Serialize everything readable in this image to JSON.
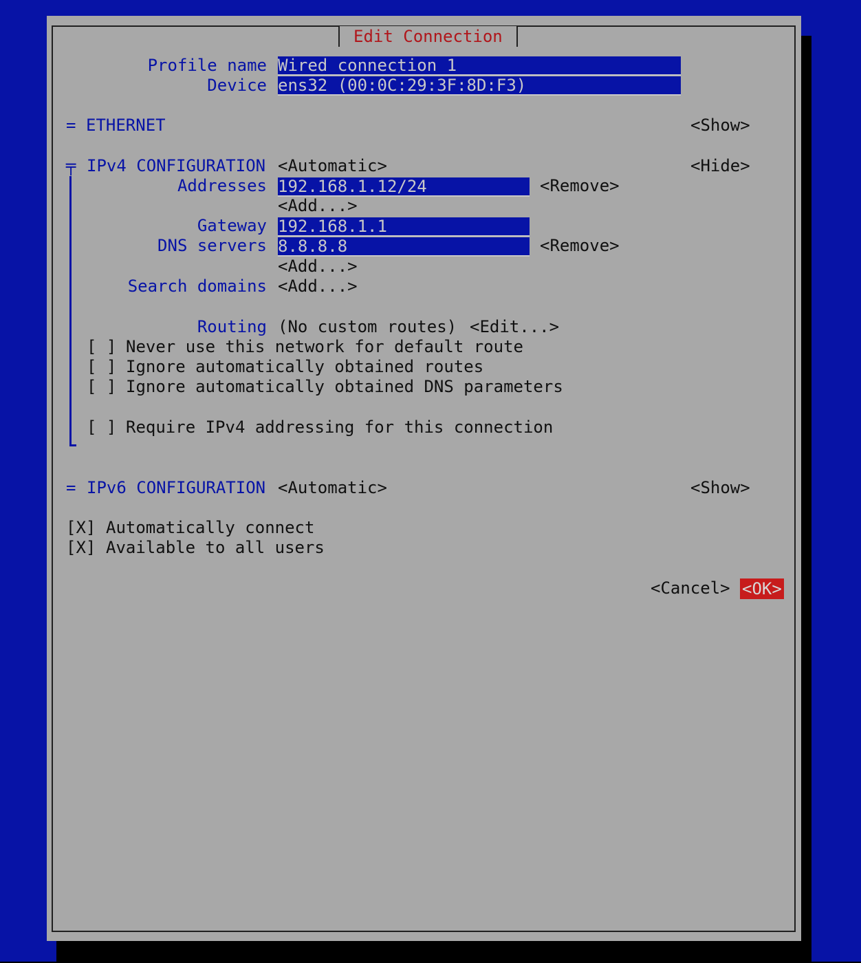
{
  "dialog": {
    "title": "Edit Connection"
  },
  "profile": {
    "name_label": "Profile name",
    "name_value": "Wired connection 1",
    "device_label": "Device",
    "device_value": "ens32 (00:0C:29:3F:8D:F3)"
  },
  "ethernet": {
    "marker": "=",
    "heading": "ETHERNET",
    "toggle": "<Show>"
  },
  "ipv4": {
    "marker": "╤",
    "heading": "IPv4 CONFIGURATION",
    "mode": "<Automatic>",
    "toggle": "<Hide>",
    "addresses_label": "Addresses",
    "address_value": "192.168.1.12/24",
    "address_remove": "<Remove>",
    "address_add": "<Add...>",
    "gateway_label": "Gateway",
    "gateway_value": "192.168.1.1",
    "dns_label": "DNS servers",
    "dns_value": "8.8.8.8",
    "dns_remove": "<Remove>",
    "dns_add": "<Add...>",
    "search_label": "Search domains",
    "search_add": "<Add...>",
    "routing_label": "Routing",
    "routing_value": "(No custom routes)",
    "routing_edit": "<Edit...>",
    "checks": [
      {
        "box": "[ ]",
        "label": "Never use this network for default route"
      },
      {
        "box": "[ ]",
        "label": "Ignore automatically obtained routes"
      },
      {
        "box": "[ ]",
        "label": "Ignore automatically obtained DNS parameters"
      },
      {
        "box": "[ ]",
        "label": "Require IPv4 addressing for this connection"
      }
    ]
  },
  "ipv6": {
    "marker": "=",
    "heading": "IPv6 CONFIGURATION",
    "mode": "<Automatic>",
    "toggle": "<Show>"
  },
  "options": [
    {
      "box": "[X]",
      "label": "Automatically connect"
    },
    {
      "box": "[X]",
      "label": "Available to all users"
    }
  ],
  "buttons": {
    "cancel": "<Cancel>",
    "ok": "<OK>"
  },
  "colors": {
    "background": "#0713a6",
    "dialog": "#a8a8a8",
    "accent": "#b0161b",
    "ok": "#c71c1c"
  }
}
